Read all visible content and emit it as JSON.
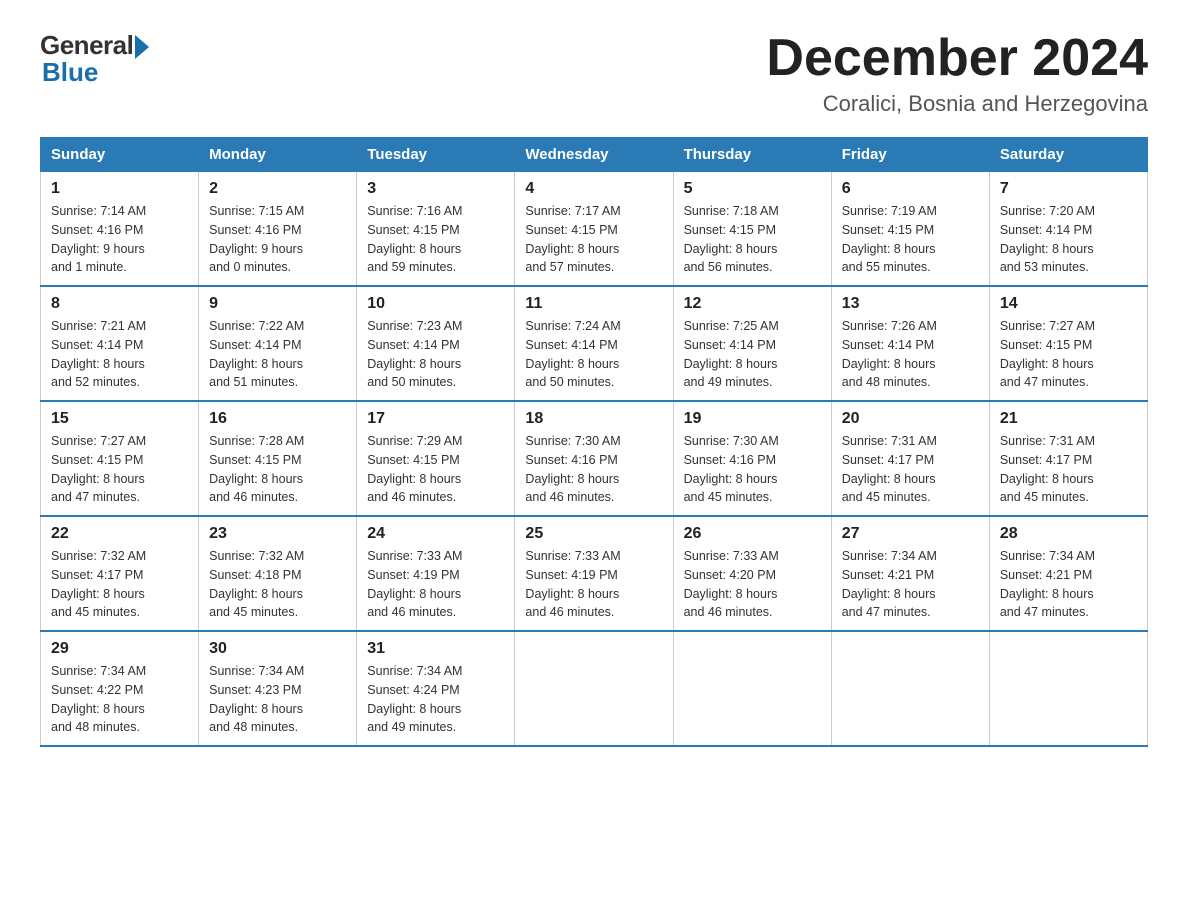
{
  "logo": {
    "general": "General",
    "blue": "Blue"
  },
  "header": {
    "month": "December 2024",
    "location": "Coralici, Bosnia and Herzegovina"
  },
  "days": [
    "Sunday",
    "Monday",
    "Tuesday",
    "Wednesday",
    "Thursday",
    "Friday",
    "Saturday"
  ],
  "weeks": [
    [
      {
        "day": "1",
        "sunrise": "7:14 AM",
        "sunset": "4:16 PM",
        "daylight": "9 hours and 1 minute."
      },
      {
        "day": "2",
        "sunrise": "7:15 AM",
        "sunset": "4:16 PM",
        "daylight": "9 hours and 0 minutes."
      },
      {
        "day": "3",
        "sunrise": "7:16 AM",
        "sunset": "4:15 PM",
        "daylight": "8 hours and 59 minutes."
      },
      {
        "day": "4",
        "sunrise": "7:17 AM",
        "sunset": "4:15 PM",
        "daylight": "8 hours and 57 minutes."
      },
      {
        "day": "5",
        "sunrise": "7:18 AM",
        "sunset": "4:15 PM",
        "daylight": "8 hours and 56 minutes."
      },
      {
        "day": "6",
        "sunrise": "7:19 AM",
        "sunset": "4:15 PM",
        "daylight": "8 hours and 55 minutes."
      },
      {
        "day": "7",
        "sunrise": "7:20 AM",
        "sunset": "4:14 PM",
        "daylight": "8 hours and 53 minutes."
      }
    ],
    [
      {
        "day": "8",
        "sunrise": "7:21 AM",
        "sunset": "4:14 PM",
        "daylight": "8 hours and 52 minutes."
      },
      {
        "day": "9",
        "sunrise": "7:22 AM",
        "sunset": "4:14 PM",
        "daylight": "8 hours and 51 minutes."
      },
      {
        "day": "10",
        "sunrise": "7:23 AM",
        "sunset": "4:14 PM",
        "daylight": "8 hours and 50 minutes."
      },
      {
        "day": "11",
        "sunrise": "7:24 AM",
        "sunset": "4:14 PM",
        "daylight": "8 hours and 50 minutes."
      },
      {
        "day": "12",
        "sunrise": "7:25 AM",
        "sunset": "4:14 PM",
        "daylight": "8 hours and 49 minutes."
      },
      {
        "day": "13",
        "sunrise": "7:26 AM",
        "sunset": "4:14 PM",
        "daylight": "8 hours and 48 minutes."
      },
      {
        "day": "14",
        "sunrise": "7:27 AM",
        "sunset": "4:15 PM",
        "daylight": "8 hours and 47 minutes."
      }
    ],
    [
      {
        "day": "15",
        "sunrise": "7:27 AM",
        "sunset": "4:15 PM",
        "daylight": "8 hours and 47 minutes."
      },
      {
        "day": "16",
        "sunrise": "7:28 AM",
        "sunset": "4:15 PM",
        "daylight": "8 hours and 46 minutes."
      },
      {
        "day": "17",
        "sunrise": "7:29 AM",
        "sunset": "4:15 PM",
        "daylight": "8 hours and 46 minutes."
      },
      {
        "day": "18",
        "sunrise": "7:30 AM",
        "sunset": "4:16 PM",
        "daylight": "8 hours and 46 minutes."
      },
      {
        "day": "19",
        "sunrise": "7:30 AM",
        "sunset": "4:16 PM",
        "daylight": "8 hours and 45 minutes."
      },
      {
        "day": "20",
        "sunrise": "7:31 AM",
        "sunset": "4:17 PM",
        "daylight": "8 hours and 45 minutes."
      },
      {
        "day": "21",
        "sunrise": "7:31 AM",
        "sunset": "4:17 PM",
        "daylight": "8 hours and 45 minutes."
      }
    ],
    [
      {
        "day": "22",
        "sunrise": "7:32 AM",
        "sunset": "4:17 PM",
        "daylight": "8 hours and 45 minutes."
      },
      {
        "day": "23",
        "sunrise": "7:32 AM",
        "sunset": "4:18 PM",
        "daylight": "8 hours and 45 minutes."
      },
      {
        "day": "24",
        "sunrise": "7:33 AM",
        "sunset": "4:19 PM",
        "daylight": "8 hours and 46 minutes."
      },
      {
        "day": "25",
        "sunrise": "7:33 AM",
        "sunset": "4:19 PM",
        "daylight": "8 hours and 46 minutes."
      },
      {
        "day": "26",
        "sunrise": "7:33 AM",
        "sunset": "4:20 PM",
        "daylight": "8 hours and 46 minutes."
      },
      {
        "day": "27",
        "sunrise": "7:34 AM",
        "sunset": "4:21 PM",
        "daylight": "8 hours and 47 minutes."
      },
      {
        "day": "28",
        "sunrise": "7:34 AM",
        "sunset": "4:21 PM",
        "daylight": "8 hours and 47 minutes."
      }
    ],
    [
      {
        "day": "29",
        "sunrise": "7:34 AM",
        "sunset": "4:22 PM",
        "daylight": "8 hours and 48 minutes."
      },
      {
        "day": "30",
        "sunrise": "7:34 AM",
        "sunset": "4:23 PM",
        "daylight": "8 hours and 48 minutes."
      },
      {
        "day": "31",
        "sunrise": "7:34 AM",
        "sunset": "4:24 PM",
        "daylight": "8 hours and 49 minutes."
      },
      null,
      null,
      null,
      null
    ]
  ],
  "labels": {
    "sunrise": "Sunrise:",
    "sunset": "Sunset:",
    "daylight": "Daylight:"
  }
}
